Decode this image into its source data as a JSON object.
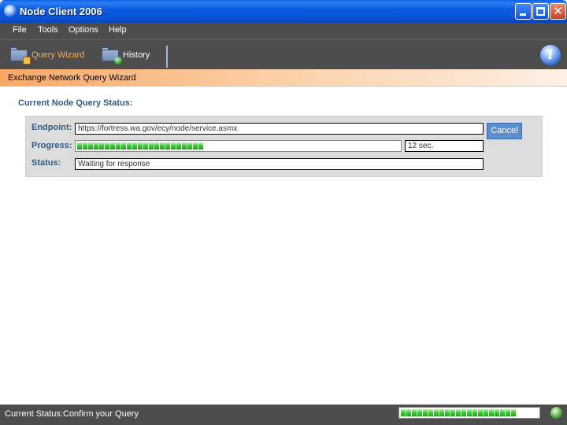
{
  "window": {
    "title": "Node Client 2006"
  },
  "menu": {
    "items": [
      "File",
      "Tools",
      "Options",
      "Help"
    ]
  },
  "toolbar": {
    "query_wizard_label": "Query Wizard",
    "history_label": "History"
  },
  "wizard": {
    "title": "Exchange Network Query Wizard"
  },
  "status_section": {
    "title": "Current Node Query Status:",
    "endpoint_label": "Endpoint:",
    "endpoint_value": "https://fortress.wa.gov/ecy/node/service.asmx",
    "progress_label": "Progress:",
    "progress_fraction": 0.41,
    "elapsed_value": "12 sec.",
    "status_label": "Status:",
    "status_value": "Waiting for response",
    "cancel_label": "Cancel"
  },
  "statusbar": {
    "label": "Current Status:",
    "value": "Confirm your Query",
    "progress_fraction": 0.85
  },
  "colors": {
    "title_bar": "#0a52d6",
    "dark_bar": "#4d4d4d",
    "accent_orange": "#f8a865",
    "label_blue": "#2f5b86",
    "progress_green": "#38c930",
    "cancel_button": "#5b8fcf"
  },
  "icons": {
    "app": "globe-icon",
    "query_wizard": "folder-document-icon",
    "history": "folder-globe-icon",
    "info": "info-icon",
    "status": "globe-icon"
  }
}
